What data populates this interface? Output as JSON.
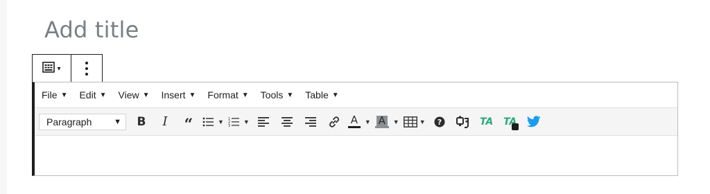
{
  "post": {
    "title_placeholder": "Add title"
  },
  "menubar": {
    "items": [
      {
        "label": "File"
      },
      {
        "label": "Edit"
      },
      {
        "label": "View"
      },
      {
        "label": "Insert"
      },
      {
        "label": "Format"
      },
      {
        "label": "Tools"
      },
      {
        "label": "Table"
      }
    ]
  },
  "toolbar": {
    "format_select": {
      "value": "Paragraph"
    },
    "tool_icons": [
      "bold-icon",
      "italic-icon",
      "blockquote-icon",
      "bullet-list-icon",
      "numbered-list-icon",
      "align-left-icon",
      "align-center-icon",
      "align-right-icon",
      "link-icon",
      "text-color-icon",
      "background-color-icon",
      "table-icon",
      "help-icon",
      "plugin-icon",
      "thirstyaffiliates-icon",
      "thirstyaffiliates-add-icon",
      "twitter-icon"
    ],
    "bold": "B",
    "italic": "I",
    "text_color_letter": "A",
    "bg_color_letter": "A",
    "ta_letters": "TA"
  },
  "colors": {
    "accent_dark": "#1e1e1e",
    "text_color_swatch": "#1e1e1e",
    "bg_color_swatch": "#8c8f94",
    "ta_green": "#2aa87a",
    "twitter_blue": "#1d9bf0"
  }
}
